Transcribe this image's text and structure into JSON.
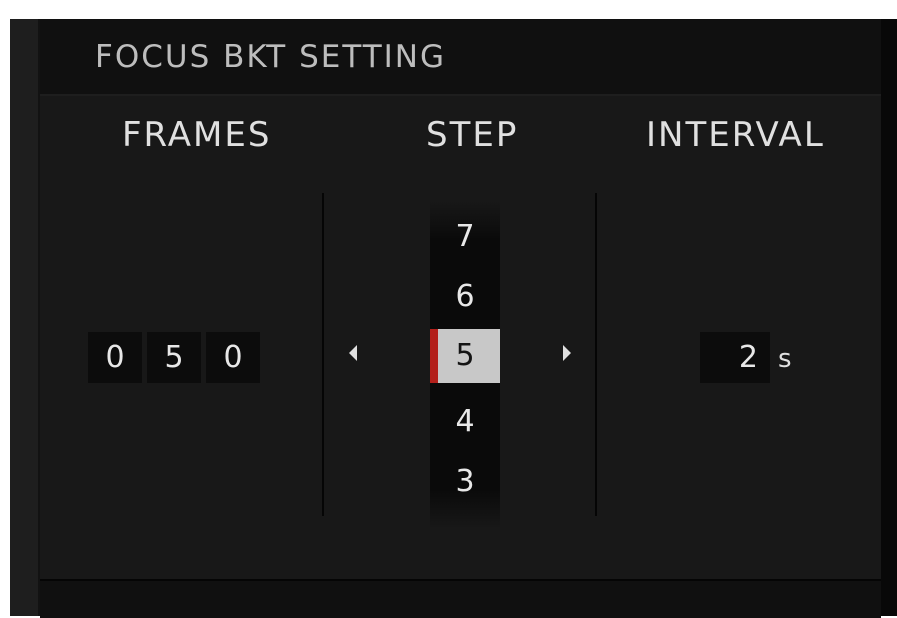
{
  "title": "FOCUS BKT SETTING",
  "columns": {
    "frames": "FRAMES",
    "step": "STEP",
    "interval": "INTERVAL"
  },
  "frames": {
    "digits": [
      "0",
      "5",
      "0"
    ]
  },
  "step": {
    "above": [
      "7",
      "6"
    ],
    "selected": "5",
    "below": [
      "4",
      "3"
    ]
  },
  "interval": {
    "value": "2",
    "unit": "s"
  },
  "colors": {
    "selection_marker": "#b3201b",
    "selection_fill": "#c8c8c8"
  }
}
